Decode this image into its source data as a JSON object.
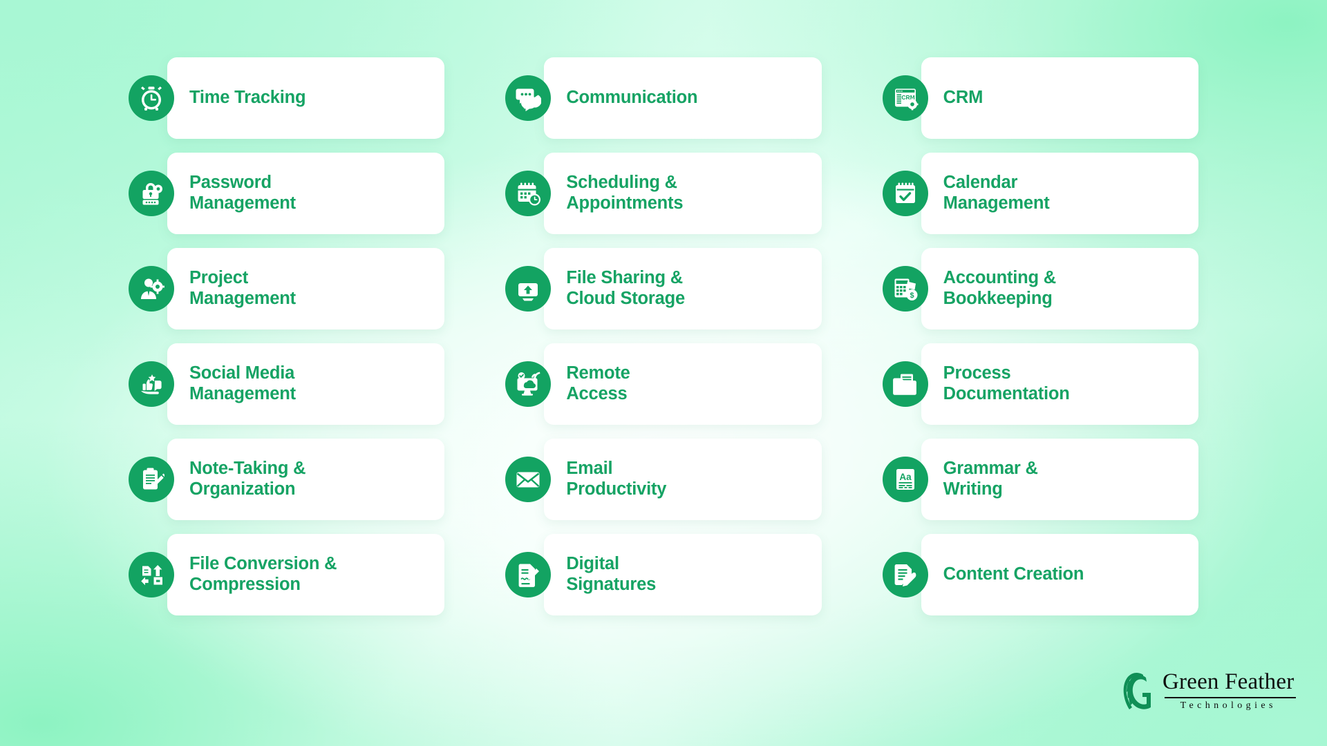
{
  "theme": {
    "accent_green": "#13A362",
    "label_green": "#16A364",
    "card_bg": "#FFFFFF",
    "background_mint_light": "#E6FFF5",
    "background_mint_dark": "#8DF3C2"
  },
  "cards": [
    {
      "id": "time-tracking",
      "label": "Time Tracking",
      "icon": "alarm-clock-icon",
      "column": 1,
      "row": 1
    },
    {
      "id": "password-management",
      "label": "Password\nManagement",
      "icon": "padlock-gear-icon",
      "column": 1,
      "row": 2
    },
    {
      "id": "project-management",
      "label": "Project\nManagement",
      "icon": "person-gear-icon",
      "column": 1,
      "row": 3
    },
    {
      "id": "social-media-management",
      "label": "Social Media\nManagement",
      "icon": "hand-thumbs-up-icon",
      "column": 1,
      "row": 4
    },
    {
      "id": "note-taking",
      "label": "Note-Taking &\nOrganization",
      "icon": "clipboard-pencil-icon",
      "column": 1,
      "row": 5
    },
    {
      "id": "file-conversion",
      "label": "File Conversion &\nCompression",
      "icon": "file-convert-icon",
      "column": 1,
      "row": 6
    },
    {
      "id": "communication",
      "label": "Communication",
      "icon": "chat-bubbles-icon",
      "column": 2,
      "row": 1
    },
    {
      "id": "scheduling",
      "label": "Scheduling &\nAppointments",
      "icon": "calendar-clock-icon",
      "column": 2,
      "row": 2
    },
    {
      "id": "file-sharing",
      "label": "File Sharing &\nCloud Storage",
      "icon": "upload-cloud-icon",
      "column": 2,
      "row": 3
    },
    {
      "id": "remote-access",
      "label": "Remote\nAccess",
      "icon": "monitor-cloud-icon",
      "column": 2,
      "row": 4
    },
    {
      "id": "email-productivity",
      "label": "Email\nProductivity",
      "icon": "envelope-icon",
      "column": 2,
      "row": 5
    },
    {
      "id": "digital-signatures",
      "label": "Digital\nSignatures",
      "icon": "signature-document-icon",
      "column": 2,
      "row": 6
    },
    {
      "id": "crm",
      "label": "CRM",
      "icon": "crm-window-gear-icon",
      "column": 3,
      "row": 1,
      "icon_text": "CRM"
    },
    {
      "id": "calendar-management",
      "label": "Calendar\nManagement",
      "icon": "calendar-check-icon",
      "column": 3,
      "row": 2
    },
    {
      "id": "accounting",
      "label": "Accounting &\nBookkeeping",
      "icon": "ledger-money-icon",
      "column": 3,
      "row": 3
    },
    {
      "id": "process-documentation",
      "label": "Process\nDocumentation",
      "icon": "folder-document-icon",
      "column": 3,
      "row": 4
    },
    {
      "id": "grammar-writing",
      "label": "Grammar &\nWriting",
      "icon": "aa-document-icon",
      "column": 3,
      "row": 5,
      "icon_text": "Aa"
    },
    {
      "id": "content-creation",
      "label": "Content Creation",
      "icon": "document-pen-icon",
      "column": 3,
      "row": 6
    }
  ],
  "logo": {
    "mark": "feather-g-monogram-icon",
    "name": "Green Feather",
    "subtitle": "Technologies"
  }
}
